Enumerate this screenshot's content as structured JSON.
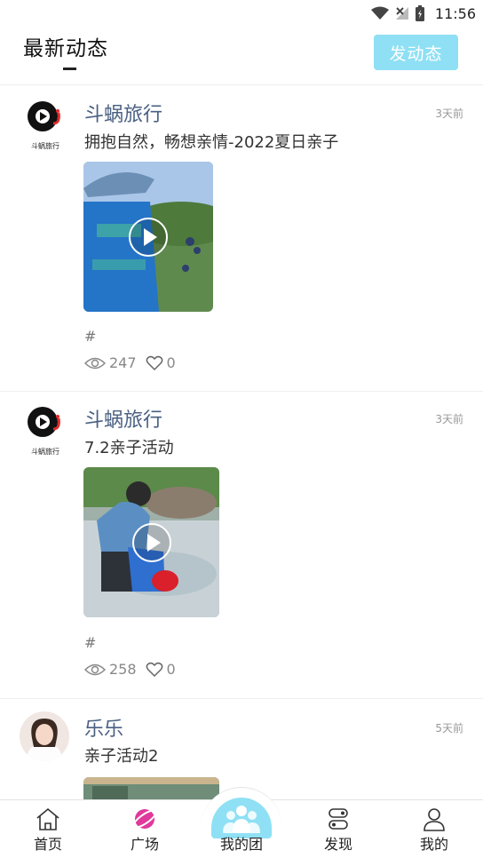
{
  "status_bar": {
    "time": "11:56",
    "icons": [
      "wifi-icon",
      "no-signal-icon",
      "battery-icon"
    ]
  },
  "header": {
    "title": "最新动态",
    "post_button": "发动态"
  },
  "feed": [
    {
      "author": "斗蜗旅行",
      "avatar_caption": "斗蜗旅行",
      "time": "3天前",
      "text": "拥抱自然，畅想亲情-2022夏日亲子",
      "hashtag": "#",
      "views": "247",
      "likes": "0"
    },
    {
      "author": "斗蜗旅行",
      "avatar_caption": "斗蜗旅行",
      "time": "3天前",
      "text": "7.2亲子活动",
      "hashtag": "#",
      "views": "258",
      "likes": "0"
    },
    {
      "author": "乐乐",
      "time": "5天前",
      "text": "亲子活动2"
    }
  ],
  "bottom_nav": [
    {
      "label": "首页",
      "icon": "home-icon"
    },
    {
      "label": "广场",
      "icon": "planet-icon"
    },
    {
      "label": "我的团",
      "icon": "group-icon"
    },
    {
      "label": "发现",
      "icon": "route-icon"
    },
    {
      "label": "我的",
      "icon": "user-icon"
    }
  ],
  "colors": {
    "accent": "#8fe0f4",
    "author": "#4a6082",
    "planet": "#e0399b"
  }
}
